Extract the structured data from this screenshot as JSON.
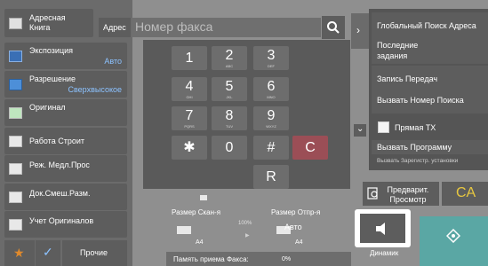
{
  "left_panel": {
    "address_book": "Адресная Книга",
    "exposure": {
      "label": "Экспозиция",
      "value": "Авто"
    },
    "resolution": {
      "label": "Разрешение",
      "value": "Сверхвысокое"
    },
    "original": "Оригинал",
    "job_build": "Работа Строит",
    "slow_scan": "Реж. Медл.Прос",
    "mixed_size": "Док.Смеш.Разм.",
    "originals_count": "Учет Оригиналов",
    "others": "Прочие"
  },
  "address_bar": {
    "address_label": "Адрес",
    "fax_placeholder": "Номер факса"
  },
  "keypad": {
    "keys": [
      {
        "digit": "1",
        "sub": ""
      },
      {
        "digit": "2",
        "sub": "ABC"
      },
      {
        "digit": "3",
        "sub": "DEF"
      },
      {
        "digit": "4",
        "sub": "GHI"
      },
      {
        "digit": "5",
        "sub": "JKL"
      },
      {
        "digit": "6",
        "sub": "MNO"
      },
      {
        "digit": "7",
        "sub": "PQRS"
      },
      {
        "digit": "8",
        "sub": "TUV"
      },
      {
        "digit": "9",
        "sub": "WXYZ"
      },
      {
        "digit": "✱",
        "sub": ""
      },
      {
        "digit": "0",
        "sub": ""
      },
      {
        "digit": "#",
        "sub": ""
      },
      {
        "digit": "C",
        "sub": ""
      },
      {
        "digit": "R",
        "sub": ""
      }
    ]
  },
  "size_info": {
    "scan_size_label": "Размер Скан-я",
    "send_size_label": "Размер Отпр-я",
    "ratio": "100%",
    "send_mode": "Авто",
    "scan_paper": "A4",
    "send_paper": "A4",
    "memory_label": "Память приема Факса:",
    "memory_value": "0%"
  },
  "right_menu": {
    "global_search": "Глобальный Поиск Адреса",
    "recent_jobs": "Последние задания",
    "record_transmission": "Запись Передач",
    "call_search": "Вызвать Номер Поиска",
    "direct_tx": "Прямая TX",
    "call_program": "Вызвать Программу",
    "call_registered": "Вызвать Зарегистр. установки"
  },
  "actions": {
    "preview": "Предварит. Просмотр",
    "ca": "CA",
    "speaker": "Динамик"
  },
  "colors": {
    "accent_blue": "#8cc2ff",
    "ca_yellow": "#e8c840",
    "star_orange": "#e08a2c",
    "start_teal": "#5aa7a4"
  }
}
